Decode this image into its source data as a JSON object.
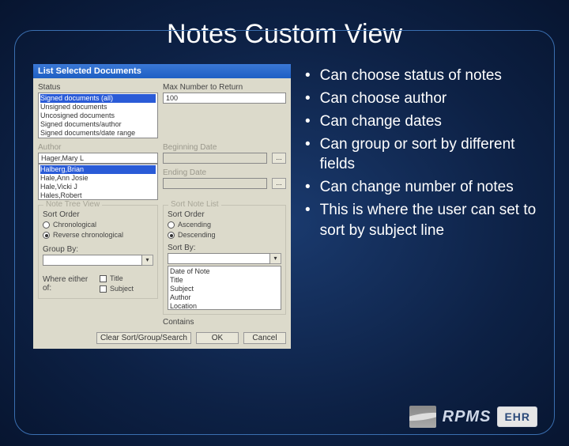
{
  "slide": {
    "title": "Notes Custom View"
  },
  "dialog": {
    "titlebar": "List Selected Documents",
    "status_label": "Status",
    "status_items": [
      "Signed documents (all)",
      "Unsigned documents",
      "Uncosigned documents",
      "Signed documents/author",
      "Signed documents/date range"
    ],
    "max_label": "Max Number to Return",
    "max_value": "100",
    "author_label": "Author",
    "author_value": "Hager,Mary L",
    "author_items": [
      "Halberg,Brian",
      "Hale,Ann Josie",
      "Hale,Vicki J",
      "Hales,Robert"
    ],
    "begin_label": "Beginning Date",
    "end_label": "Ending Date",
    "sort_group": "Sort Order",
    "sort_asc": "Ascending",
    "sort_desc": "Descending",
    "sortby_label": "Sort By:",
    "sortby_items": [
      "Date of Note",
      "Title",
      "Subject",
      "Author",
      "Location"
    ],
    "tree_group": "Note Tree View",
    "tree_chrono": "Chronological",
    "tree_rev": "Reverse chronological",
    "groupby_label": "Group By:",
    "sortlist_group": "Sort Note List",
    "contains_label": "Contains",
    "where_label": "Where either of:",
    "chk_title": "Title",
    "chk_subject": "Subject",
    "clear_btn": "Clear Sort/Group/Search",
    "ok_btn": "OK",
    "cancel_btn": "Cancel",
    "ellipsis": "..."
  },
  "bullets": {
    "b1": "Can choose status of notes",
    "b2": "Can choose author",
    "b3": "Can change dates",
    "b4": "Can group or sort by different fields",
    "b5": "Can change number of notes",
    "b6": "This is where the user can set to sort by subject line"
  },
  "logo": {
    "rpms": "RPMS",
    "ehr": "EHR"
  }
}
